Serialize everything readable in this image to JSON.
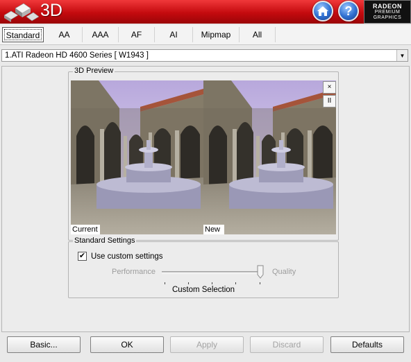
{
  "header": {
    "title": "3D",
    "home_icon": "home-icon",
    "help_label": "?",
    "badge_line1": "RADEON",
    "badge_line2": "PREMIUM",
    "badge_line3": "GRAPHICS",
    "accent_color": "#c40a0e"
  },
  "tabs": [
    {
      "label": "Standard",
      "active": true
    },
    {
      "label": "AA"
    },
    {
      "label": "AAA"
    },
    {
      "label": "AF"
    },
    {
      "label": "AI"
    },
    {
      "label": "Mipmap"
    },
    {
      "label": "All"
    }
  ],
  "adapter": {
    "selected": "1.ATI Radeon HD 4600 Series  [ W1943 ]",
    "arrow": "▼"
  },
  "preview": {
    "legend": "3D Preview",
    "current_label": "Current",
    "new_label": "New",
    "close_label": "×",
    "pause_label": "II"
  },
  "settings": {
    "legend": "Standard Settings",
    "use_custom_label": "Use custom settings",
    "use_custom_checked": true,
    "checkmark": "✔",
    "performance_label": "Performance",
    "quality_label": "Quality",
    "slider_level": 1.0,
    "selection_label": "Custom Selection"
  },
  "buttons": {
    "basic": "Basic...",
    "ok": "OK",
    "apply": "Apply",
    "discard": "Discard",
    "defaults": "Defaults"
  }
}
